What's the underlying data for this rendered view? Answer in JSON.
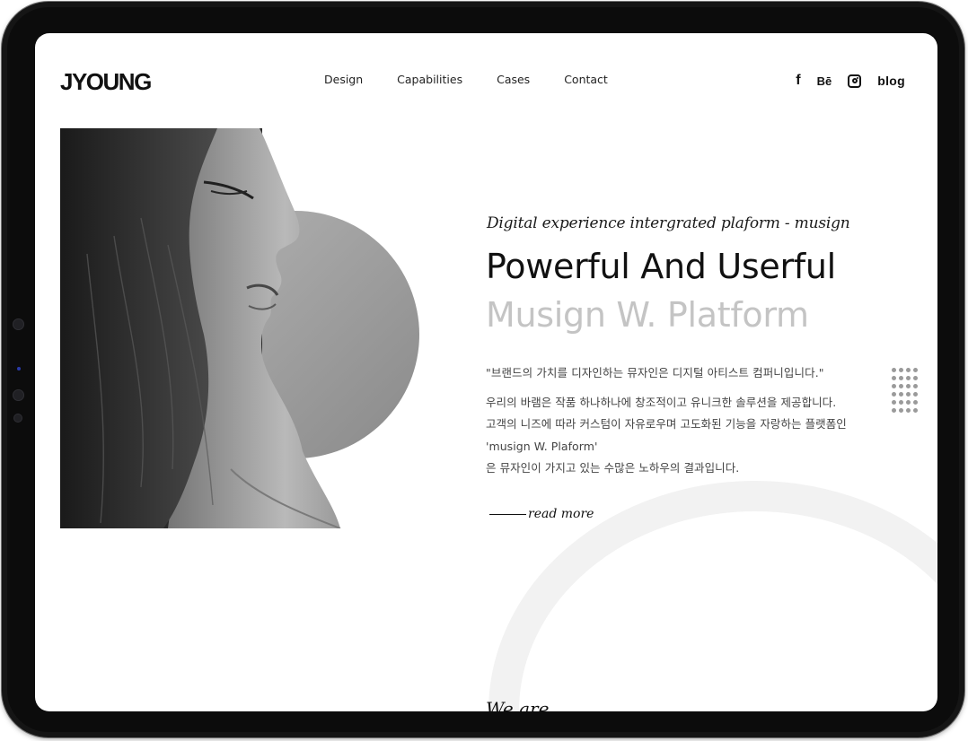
{
  "header": {
    "logo": "JYOUNG",
    "nav": [
      "Design",
      "Capabilities",
      "Cases",
      "Contact"
    ],
    "social": {
      "facebook": "f",
      "behance": "Bē",
      "instagram_icon": "instagram-icon",
      "blog": "blog"
    }
  },
  "hero": {
    "tagline": "Digital experience intergrated plaform - musign",
    "headline": "Powerful And Userful",
    "subheadline": "Musign W. Platform",
    "quote": "\"브랜드의 가치를 디자인하는 뮤자인은 디지털 아티스트 컴퍼니입니다.\"",
    "description": [
      "우리의 바램은 작품 하나하나에 창조적이고 유니크한 솔루션을 제공합니다.",
      "고객의 니즈에 따라 커스텀이 자유로우며 고도화된 기능을 자랑하는 플랫폼인",
      "'musign W. Plaform'",
      "은 뮤자인이 가지고 있는 수많은 노하우의 결과입니다."
    ],
    "read_more": "read more",
    "image": "monochrome-woman-profile-portrait"
  },
  "next_section": {
    "heading": "We are ...."
  },
  "colors": {
    "text_dark": "#111111",
    "text_muted": "#c4c4c4",
    "body_text": "#444444",
    "circle_gray": "#9c9c9c",
    "device_bezel": "#151515"
  }
}
